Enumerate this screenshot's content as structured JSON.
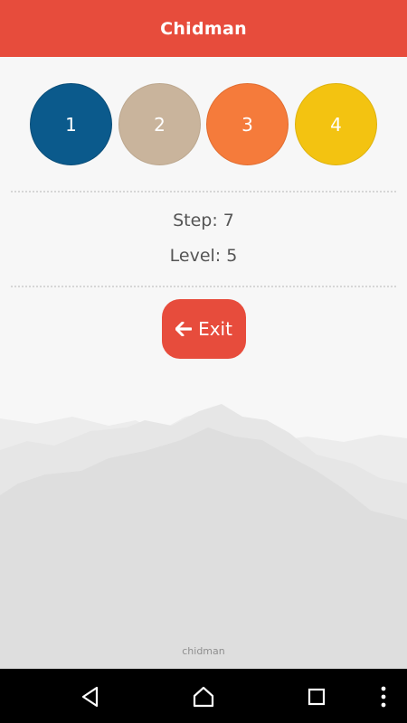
{
  "app": {
    "title": "Chidman"
  },
  "circles": [
    {
      "label": "1",
      "color": "#0b5a8c"
    },
    {
      "label": "2",
      "color": "#c9b49c"
    },
    {
      "label": "3",
      "color": "#f57b3b"
    },
    {
      "label": "4",
      "color": "#f3c311"
    }
  ],
  "stats": {
    "step": "Step: 7",
    "level": "Level: 5"
  },
  "exit": {
    "label": "Exit",
    "icon": "arrow-left-icon",
    "color": "#e74c3c"
  },
  "footer": {
    "text": "chidman"
  },
  "nav": {
    "icons": [
      "back-icon",
      "home-icon",
      "recents-icon",
      "more-icon"
    ]
  }
}
